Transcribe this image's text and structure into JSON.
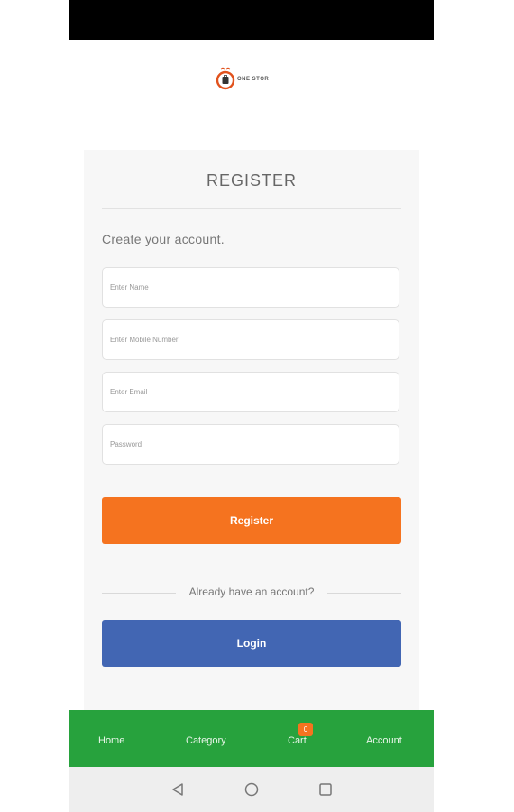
{
  "app": {
    "brand": "ONE STOR"
  },
  "form": {
    "title": "REGISTER",
    "subtitle": "Create your account.",
    "fields": {
      "name_placeholder": "Enter Name",
      "mobile_placeholder": "Enter Mobile Number",
      "email_placeholder": "Enter Email",
      "password_placeholder": "Password"
    },
    "register_label": "Register",
    "already_text": "Already have an account?",
    "login_label": "Login"
  },
  "bottom_nav": {
    "home": "Home",
    "category": "Category",
    "cart": "Cart",
    "cart_count": "0",
    "account": "Account"
  },
  "colors": {
    "primary_orange": "#f5731f",
    "login_blue": "#4266b3",
    "nav_green": "#27a23d"
  },
  "icons": [
    "logo-icon",
    "back-icon",
    "home-circle-icon",
    "recents-square-icon"
  ]
}
